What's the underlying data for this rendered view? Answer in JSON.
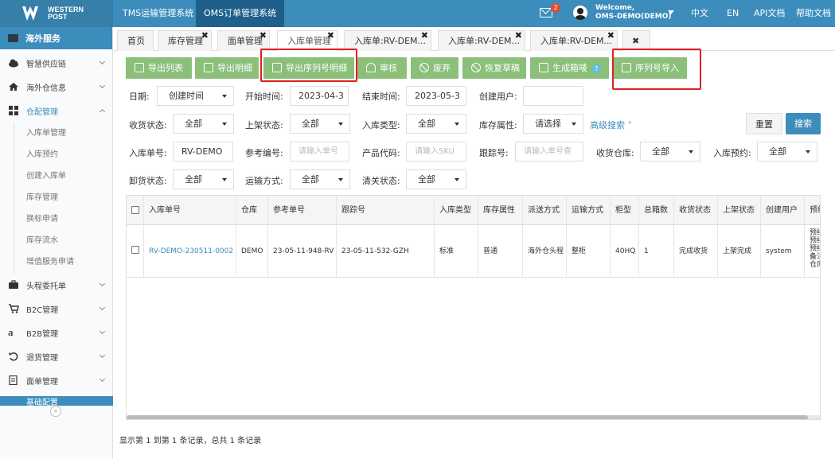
{
  "header": {
    "logo_line1": "WESTERN",
    "logo_line2": "POST",
    "sys_tabs": [
      "TMS运输管理系统",
      "OMS订单管理系统"
    ],
    "mail_count": "2",
    "welcome": "Welcome,",
    "user": "OMS-DEMO(DEMO)",
    "nav": [
      "中文",
      "EN",
      "API文档",
      "帮助文档"
    ]
  },
  "sidebar": {
    "section": "海外服务",
    "groups": [
      {
        "label": "智慧供应链",
        "icon": "cloud-icon"
      },
      {
        "label": "海外仓信息",
        "icon": "home-icon"
      },
      {
        "label": "仓配管理",
        "icon": "grid-icon"
      }
    ],
    "subs": [
      "入库单管理",
      "入库预约",
      "创建入库单",
      "库存管理",
      "换标申请",
      "库存流水",
      "增值服务申请"
    ],
    "groups2": [
      {
        "label": "头程委托单",
        "icon": "briefcase-icon"
      },
      {
        "label": "B2C管理",
        "icon": "cart-icon"
      },
      {
        "label": "B2B管理",
        "icon": "amazon-icon"
      },
      {
        "label": "退货管理",
        "icon": "return-icon"
      },
      {
        "label": "面单管理",
        "icon": "doc-icon"
      }
    ],
    "footer": "基础配置"
  },
  "tabs": [
    "首页",
    "库存管理",
    "面单管理",
    "入库单管理",
    "入库单:RV-DEM...",
    "入库单:RV-DEM...",
    "入库单:RV-DEM..."
  ],
  "toolbar": [
    "导出列表",
    "导出明细",
    "导出序列号明细",
    "审核",
    "废弃",
    "恢复草稿",
    "生成箱唛",
    "序列号导入"
  ],
  "form": {
    "date_label": "日期:",
    "date_type": "创建时间",
    "start_label": "开始时间:",
    "start": "2023-04-3",
    "end_label": "结束时间:",
    "end": "2023-05-3",
    "creator_label": "创建用户:",
    "recv_label": "收货状态:",
    "recv": "全部",
    "shelf_label": "上架状态:",
    "shelf": "全部",
    "type_label": "入库类型:",
    "type": "全部",
    "attr_label": "库存属性:",
    "attr": "请选择",
    "advanced": "高级搜索",
    "reset": "重置",
    "search": "搜索",
    "no_label": "入库单号:",
    "no": "RV-DEMO",
    "ref_label": "参考编号:",
    "ref_ph": "请输入单号",
    "sku_label": "产品代码:",
    "sku_ph": "请输入SKU",
    "track_label": "跟踪号:",
    "track_ph": "请输入单号查",
    "wh_label": "收货仓库:",
    "wh": "全部",
    "appt_label": "入库预约:",
    "appt": "全部",
    "unload_label": "卸货状态:",
    "unload": "全部",
    "ship_label": "运输方式:",
    "ship": "全部",
    "clear_label": "清关状态:",
    "clear": "全部"
  },
  "table": {
    "headers": [
      "入库单号",
      "仓库",
      "参考单号",
      "跟踪号",
      "入库类型",
      "库存属性",
      "派送方式",
      "运输方式",
      "柜型",
      "总箱数",
      "收货状态",
      "上架状态",
      "创建用户",
      "预约"
    ],
    "row": [
      "RV-DEMO-230511-0002",
      "DEMO",
      "23-05-11-948-RV",
      "23-05-11-532-GZH",
      "标准",
      "普通",
      "海外仓头程",
      "整柜",
      "40HQ",
      "1",
      "完成收货",
      "上架完成",
      "system"
    ],
    "last_col": [
      "预约",
      "预约",
      "预约",
      "备注",
      "仓库"
    ]
  },
  "footer": "显示第 1 到第 1 条记录，总共 1 条记录"
}
